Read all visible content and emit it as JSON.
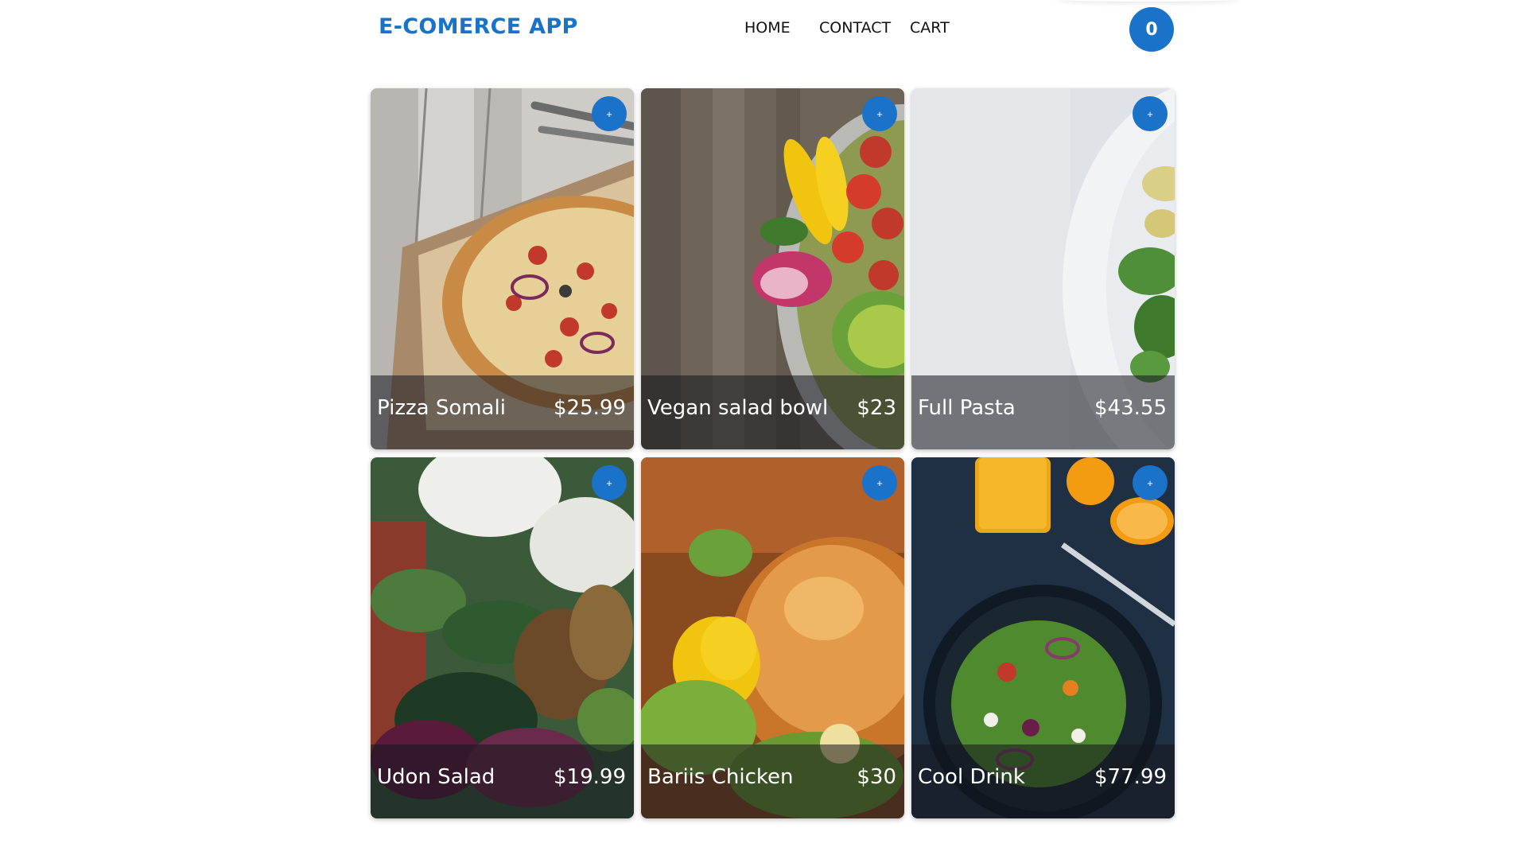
{
  "header": {
    "brand": "E-COMERCE APP",
    "nav": {
      "home": "HOME",
      "contact": "CONTACT",
      "cart": "CART"
    },
    "cart_count": "0"
  },
  "colors": {
    "accent": "#1a73c8"
  },
  "products": [
    {
      "name": "Pizza Somali",
      "price": "$25.99",
      "add_label": "+",
      "image": "pizza-photo"
    },
    {
      "name": "Vegan salad bowl",
      "price": "$23",
      "add_label": "+",
      "image": "vegan-salad-photo"
    },
    {
      "name": "Full Pasta",
      "price": "$43.55",
      "add_label": "+",
      "image": "pasta-photo"
    },
    {
      "name": "Udon Salad",
      "price": "$19.99",
      "add_label": "+",
      "image": "udon-salad-photo"
    },
    {
      "name": "Bariis Chicken",
      "price": "$30",
      "add_label": "+",
      "image": "roast-chicken-photo"
    },
    {
      "name": "Cool Drink",
      "price": "$77.99",
      "add_label": "+",
      "image": "salad-and-juice-photo"
    }
  ]
}
